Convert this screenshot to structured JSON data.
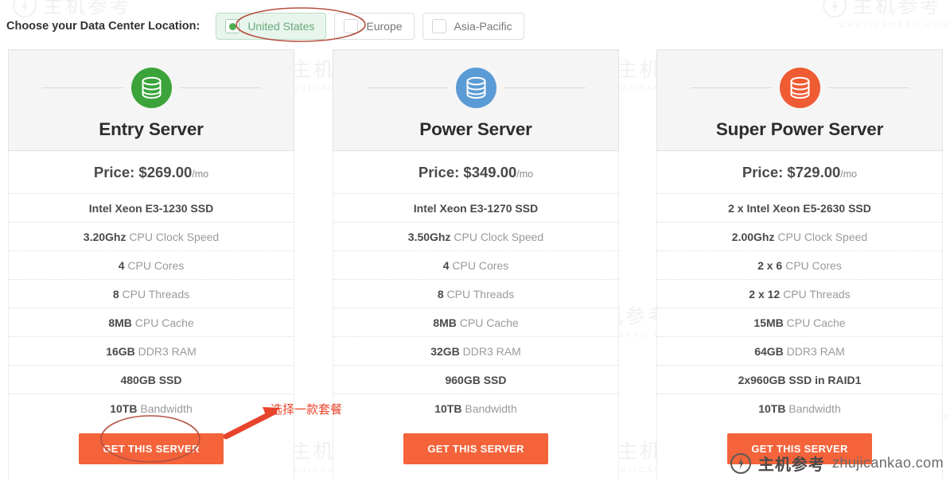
{
  "chooser": {
    "label": "Choose your Data Center Location:",
    "options": [
      {
        "label": "United States",
        "selected": true
      },
      {
        "label": "Europe",
        "selected": false
      },
      {
        "label": "Asia-Pacific",
        "selected": false
      }
    ]
  },
  "colors": {
    "entry_icon": "#3aa43a",
    "power_icon": "#5b9bd5",
    "super_icon": "#ef5b33",
    "cta": "#f4633a",
    "annotation": "#e8442c",
    "selected_option_bg": "#e8f5ec",
    "selected_option_text": "#6aa87e"
  },
  "plans": [
    {
      "icon_name": "database-icon",
      "title": "Entry Server",
      "price_main": "Price: $269.00",
      "price_unit": "/mo",
      "specs": [
        {
          "strong": "Intel Xeon E3-1230 SSD",
          "rest": "",
          "all_bold": true
        },
        {
          "strong": "3.20Ghz",
          "rest": " CPU Clock Speed",
          "all_bold": false
        },
        {
          "strong": "4",
          "rest": " CPU Cores",
          "all_bold": false
        },
        {
          "strong": "8",
          "rest": " CPU Threads",
          "all_bold": false
        },
        {
          "strong": "8MB",
          "rest": " CPU Cache",
          "all_bold": false
        },
        {
          "strong": "16GB",
          "rest": " DDR3 RAM",
          "all_bold": false
        },
        {
          "strong": "480GB SSD",
          "rest": "",
          "all_bold": true
        },
        {
          "strong": "10TB",
          "rest": " Bandwidth",
          "all_bold": false
        }
      ],
      "cta_label": "GET THIS SERVER"
    },
    {
      "icon_name": "database-icon",
      "title": "Power Server",
      "price_main": "Price: $349.00",
      "price_unit": "/mo",
      "specs": [
        {
          "strong": "Intel Xeon E3-1270 SSD",
          "rest": "",
          "all_bold": true
        },
        {
          "strong": "3.50Ghz",
          "rest": " CPU Clock Speed",
          "all_bold": false
        },
        {
          "strong": "4",
          "rest": " CPU Cores",
          "all_bold": false
        },
        {
          "strong": "8",
          "rest": " CPU Threads",
          "all_bold": false
        },
        {
          "strong": "8MB",
          "rest": " CPU Cache",
          "all_bold": false
        },
        {
          "strong": "32GB",
          "rest": " DDR3 RAM",
          "all_bold": false
        },
        {
          "strong": "960GB SSD",
          "rest": "",
          "all_bold": true
        },
        {
          "strong": "10TB",
          "rest": " Bandwidth",
          "all_bold": false
        }
      ],
      "cta_label": "GET THIS SERVER"
    },
    {
      "icon_name": "database-icon",
      "title": "Super Power Server",
      "price_main": "Price: $729.00",
      "price_unit": "/mo",
      "specs": [
        {
          "strong": "2 x Intel Xeon E5-2630 SSD",
          "rest": "",
          "all_bold": true
        },
        {
          "strong": "2.00Ghz",
          "rest": " CPU Clock Speed",
          "all_bold": false
        },
        {
          "strong": "2 x 6",
          "rest": " CPU Cores",
          "all_bold": false
        },
        {
          "strong": "2 x 12",
          "rest": " CPU Threads",
          "all_bold": false
        },
        {
          "strong": "15MB",
          "rest": " CPU Cache",
          "all_bold": false
        },
        {
          "strong": "64GB",
          "rest": " DDR3 RAM",
          "all_bold": false
        },
        {
          "strong": "2x960GB SSD in RAID1",
          "rest": "",
          "all_bold": true
        },
        {
          "strong": "10TB",
          "rest": " Bandwidth",
          "all_bold": false
        }
      ],
      "cta_label": "GET THIS SERVER"
    }
  ],
  "annotations": {
    "arrow_text": "选择一款套餐"
  },
  "watermark": {
    "cn": "主机参考",
    "en": "ZHUJICANKAO.COM"
  },
  "brand": {
    "cn": "主机参考",
    "url": "zhujicankao.com"
  }
}
